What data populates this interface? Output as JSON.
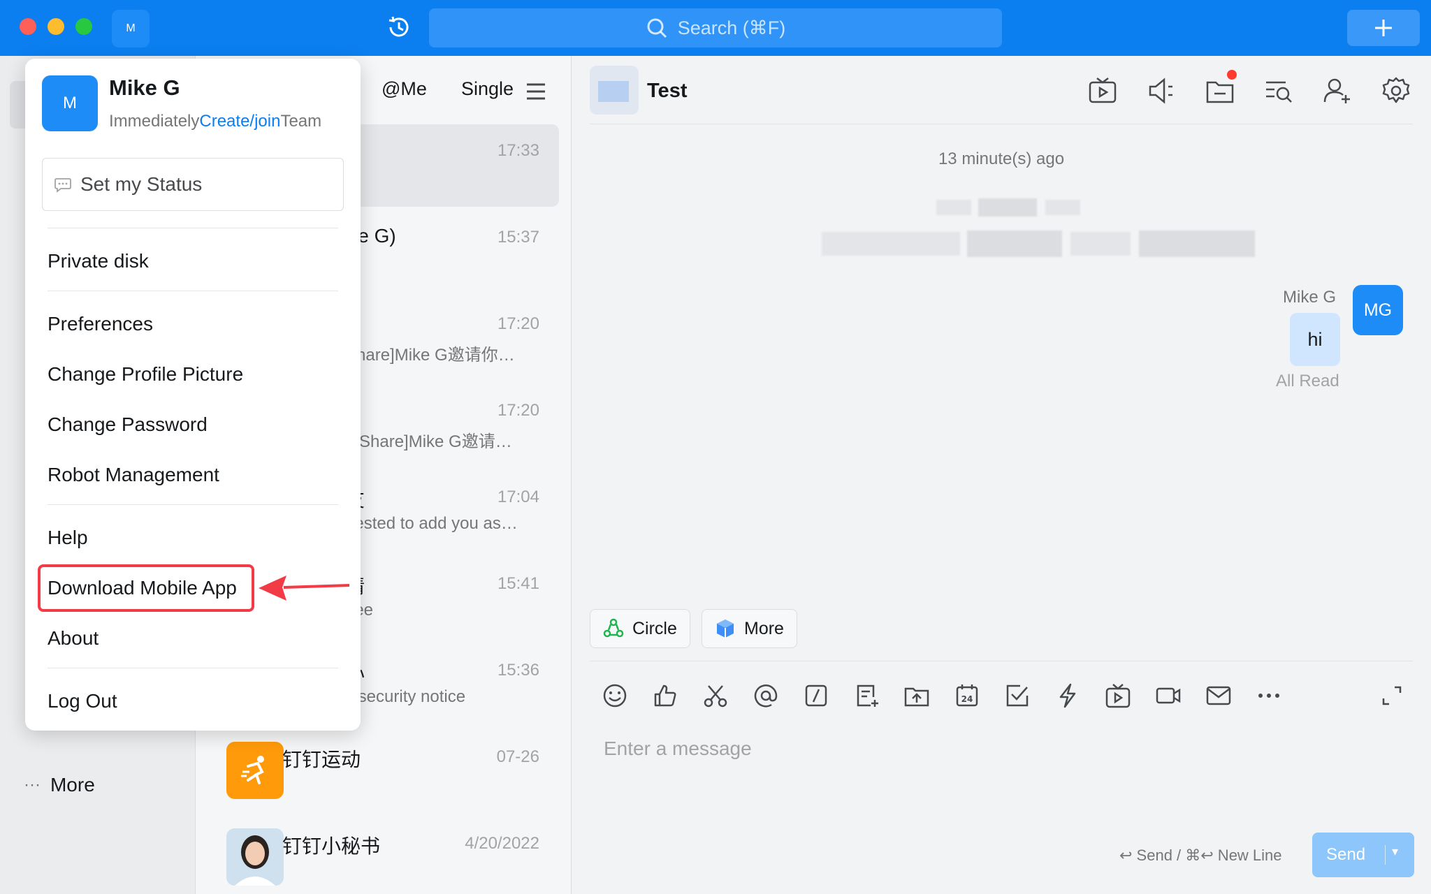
{
  "titlebar": {
    "avatar_initial": "M",
    "search_placeholder": "Search (⌘F)"
  },
  "leftnav": {
    "more_label": "More"
  },
  "conversation_list": {
    "tabs": [
      "@Me",
      "Single"
    ],
    "items": [
      {
        "title": "",
        "preview": "",
        "time": "17:33",
        "active": true
      },
      {
        "title": "ike G)",
        "preview": "",
        "time": "15:37"
      },
      {
        "title": "",
        "preview": "Share]Mike G邀请你…",
        "time": "17:20"
      },
      {
        "title": "",
        "preview": "] [Share]Mike G邀请…",
        "time": "17:20"
      },
      {
        "title": "友",
        "preview": "uested to add you as…",
        "time": "17:04"
      },
      {
        "title": "请",
        "preview": "] ee",
        "time": "15:41"
      },
      {
        "title": "心",
        "preview": "k security notice",
        "time": "15:36"
      },
      {
        "title": "钉钉运动",
        "preview": "",
        "time": "07-26"
      },
      {
        "title": "钉钉小秘书",
        "preview": "",
        "time": "4/20/2022"
      }
    ]
  },
  "chat": {
    "title": "Test",
    "timestamp": "13 minute(s) ago",
    "message": {
      "sender": "Mike G",
      "sender_initials": "MG",
      "text": "hi",
      "status": "All Read"
    },
    "quick_buttons": [
      "Circle",
      "More"
    ],
    "input_placeholder": "Enter a message",
    "send_hint": "↩ Send / ⌘↩ New Line",
    "send_label": "Send"
  },
  "popup": {
    "avatar_initial": "M",
    "name": "Mike G",
    "team_prefix": "Immediately",
    "team_link": "Create/join",
    "team_suffix": "Team",
    "status_placeholder": "Set my Status",
    "items": {
      "private_disk": "Private disk",
      "preferences": "Preferences",
      "change_profile_picture": "Change Profile Picture",
      "change_password": "Change Password",
      "robot_management": "Robot Management",
      "help": "Help",
      "download_mobile_app": "Download Mobile App",
      "about": "About",
      "log_out": "Log Out"
    }
  },
  "colors": {
    "titlebar_blue": "#0b7ff0",
    "accent": "#1e8cf7",
    "annotation_red": "#f23b45"
  }
}
